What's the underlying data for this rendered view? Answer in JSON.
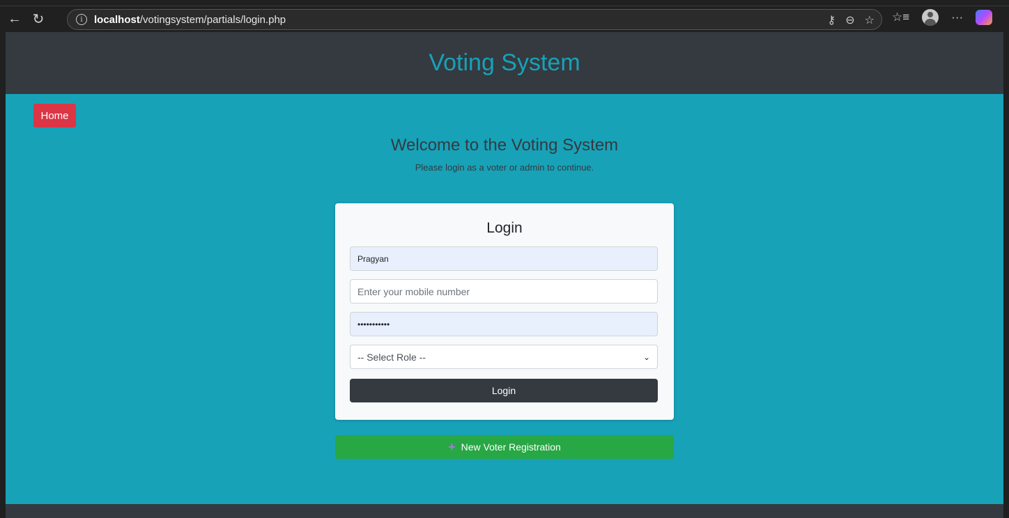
{
  "browser": {
    "url_host": "localhost",
    "url_path": "/votingsystem/partials/login.php"
  },
  "header": {
    "title": "Voting System"
  },
  "nav": {
    "home_label": "Home"
  },
  "welcome": {
    "heading": "Welcome to the Voting System",
    "subtext": "Please login as a voter or admin to continue."
  },
  "login_form": {
    "title": "Login",
    "username_value": "Pragyan",
    "mobile_placeholder": "Enter your mobile number",
    "password_value": "•••••••••••",
    "role_selected": "-- Select Role --",
    "submit_label": "Login"
  },
  "registration": {
    "label": "New Voter Registration"
  },
  "colors": {
    "header_bg": "#343a40",
    "title": "#17a2b8",
    "main_bg": "#17a2b8",
    "home_button": "#dc3545",
    "login_button": "#343a40",
    "register_button": "#28a745"
  }
}
